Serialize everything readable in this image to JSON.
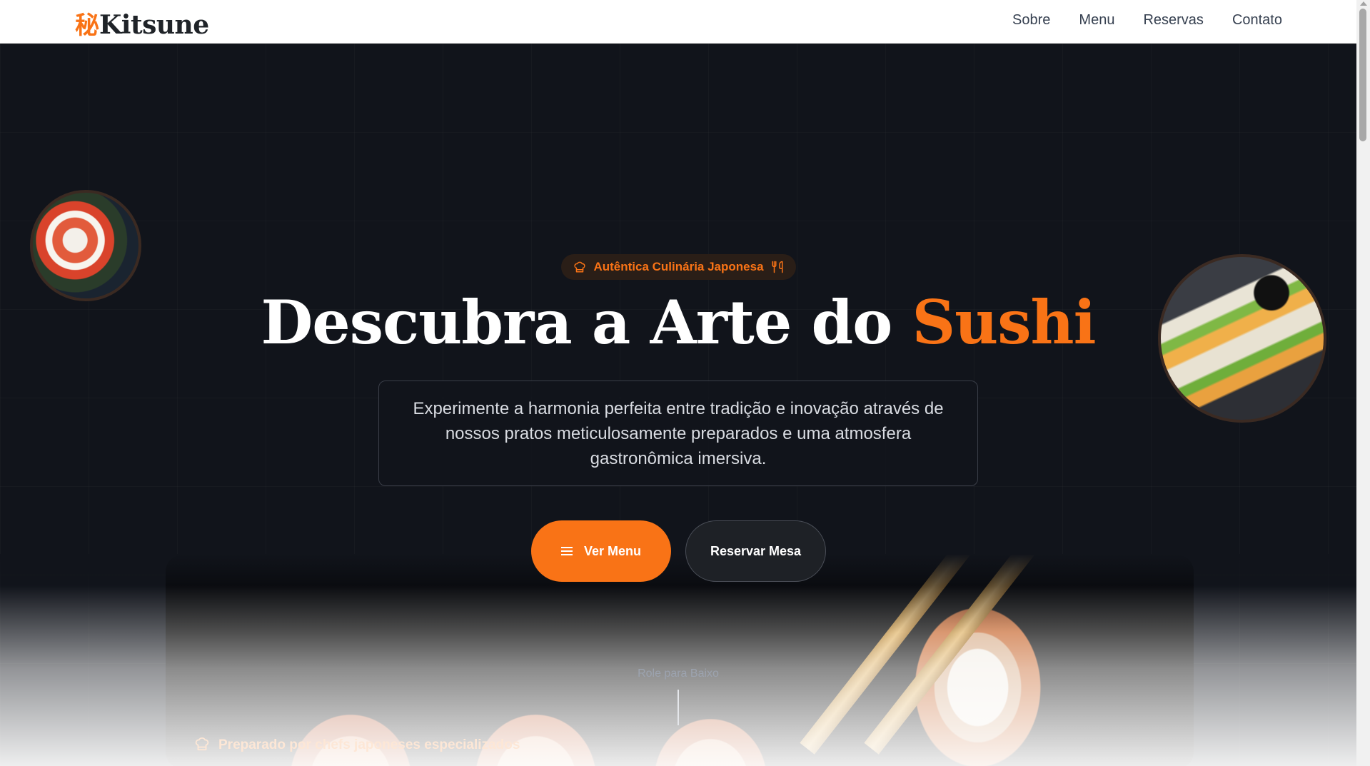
{
  "brand": {
    "kanji": "秘",
    "name": "Kitsune"
  },
  "nav": {
    "items": [
      "Sobre",
      "Menu",
      "Reservas",
      "Contato"
    ]
  },
  "hero": {
    "badge": "Autêntica Culinária Japonesa",
    "title_part1": "Descubra a Arte do ",
    "title_accent": "Sushi",
    "description": "Experimente a harmonia perfeita entre tradição e inovação através de nossos pratos meticulosamente preparados e uma atmosfera gastronômica imersiva.",
    "primary_button": "Ver Menu",
    "secondary_button": "Reservar Mesa",
    "scroll_cue": "Role para Baixo",
    "chef_note": "Preparado por chefs japoneses especializados"
  },
  "colors": {
    "accent": "#f97316",
    "background": "#11141b",
    "navbar": "#ffffff"
  },
  "icons": {
    "badge_left": "chef-hat-icon",
    "badge_right": "utensils-icon",
    "menu": "menu-lines-icon",
    "chef_note": "chef-hat-icon"
  }
}
